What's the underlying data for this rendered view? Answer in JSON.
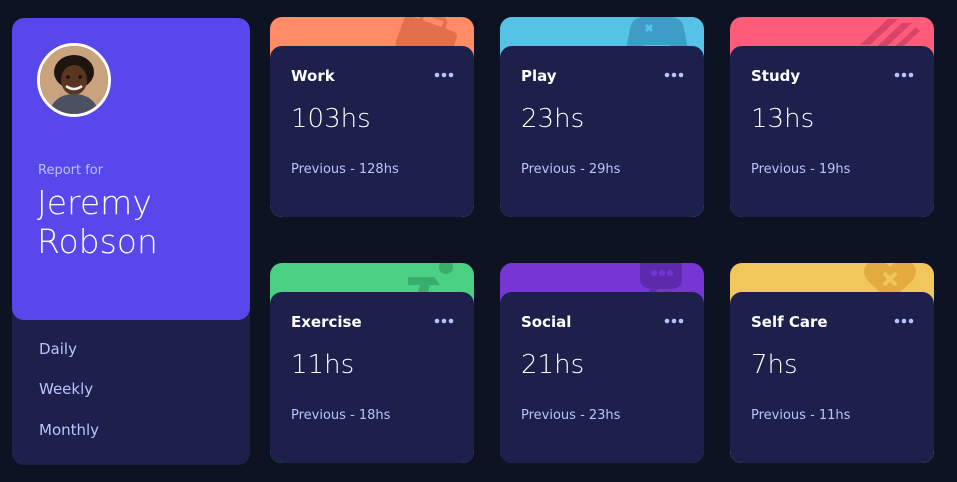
{
  "profile": {
    "report_label": "Report for",
    "name": "Jeremy Robson"
  },
  "periods": [
    {
      "label": "Daily"
    },
    {
      "label": "Weekly"
    },
    {
      "label": "Monthly"
    }
  ],
  "activities": [
    {
      "title": "Work",
      "current": "103hs",
      "previous": "Previous - 128hs",
      "color": "#ff8c66",
      "icon": "briefcase-icon"
    },
    {
      "title": "Play",
      "current": "23hs",
      "previous": "Previous - 29hs",
      "color": "#56c2e6",
      "icon": "gamepad-icon"
    },
    {
      "title": "Study",
      "current": "13hs",
      "previous": "Previous - 19hs",
      "color": "#ff5c7c",
      "icon": "books-icon"
    },
    {
      "title": "Exercise",
      "current": "11hs",
      "previous": "Previous - 18hs",
      "color": "#4bcf83",
      "icon": "runner-icon"
    },
    {
      "title": "Social",
      "current": "21hs",
      "previous": "Previous - 23hs",
      "color": "#7536d3",
      "icon": "chat-icon"
    },
    {
      "title": "Self Care",
      "current": "7hs",
      "previous": "Previous - 11hs",
      "color": "#f1c65b",
      "icon": "heart-icon"
    }
  ]
}
